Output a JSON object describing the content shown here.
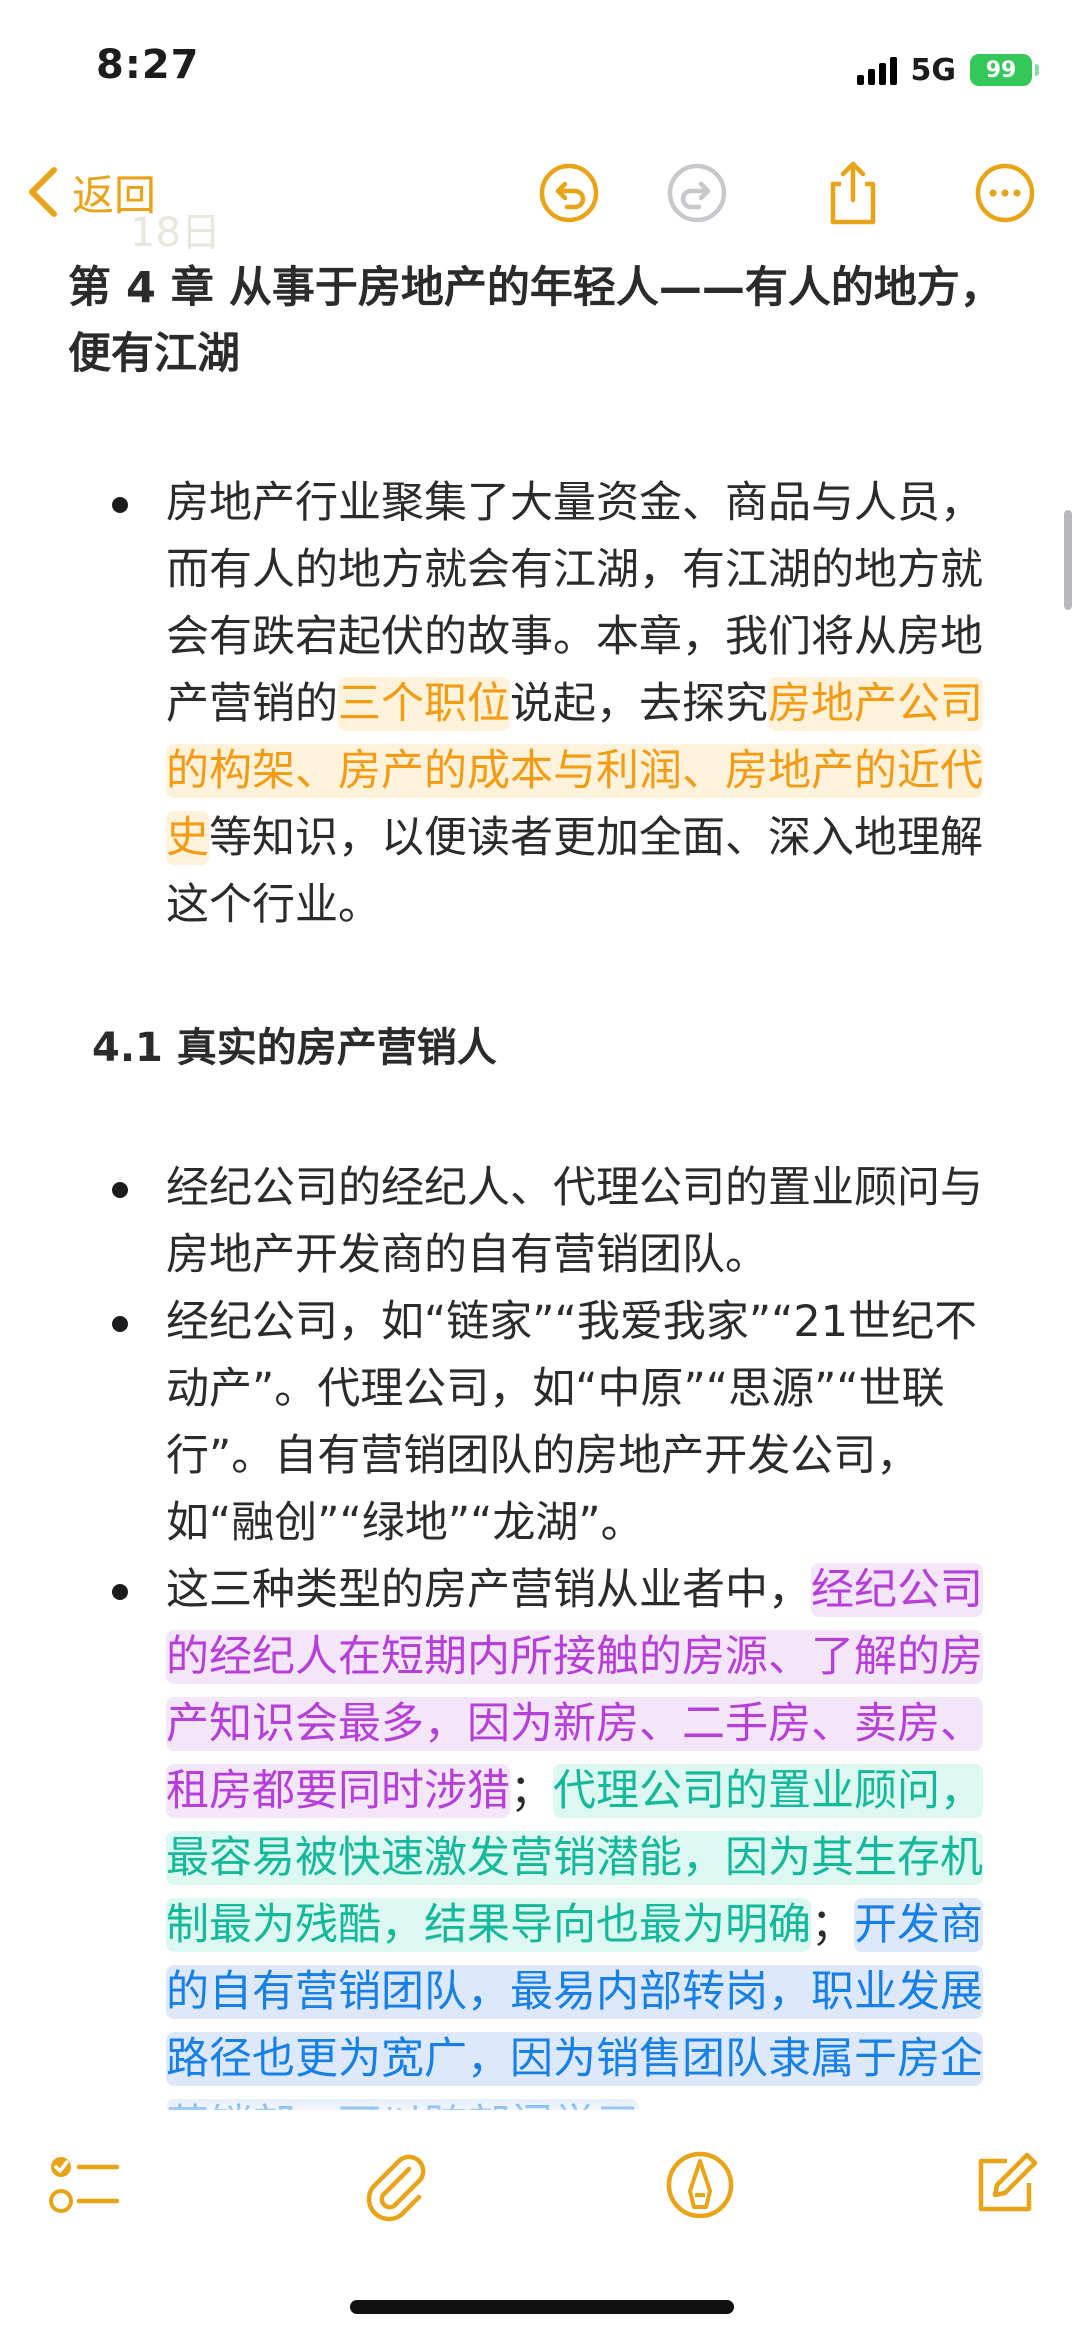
{
  "status_bar": {
    "time": "8:27",
    "network": "5G",
    "battery": "99"
  },
  "nav": {
    "back_label": "返回"
  },
  "ghost": {
    "top_line": "",
    "sub_line": "18日"
  },
  "chapter_title": "第 4 章 从事于房地产的年轻人——有人的地方，便有江湖",
  "bullets_intro": [
    {
      "parts": [
        {
          "text": "房地产行业聚集了大量资金、商品与人员，而有人的地方就会有江湖，有江湖的地方就会有跌宕起伏的故事。本章，我们将从房地产营销的",
          "hl": ""
        },
        {
          "text": "三个职位",
          "hl": "orange"
        },
        {
          "text": "说起，去探究",
          "hl": ""
        },
        {
          "text": "房地产公司的构架、房产的成本与利润、房地产的近代史",
          "hl": "orange"
        },
        {
          "text": "等知识，以便读者更加全面、深入地理解这个行业。",
          "hl": ""
        }
      ]
    }
  ],
  "section_title": "4.1 真实的房产营销人",
  "bullets_section": [
    {
      "parts": [
        {
          "text": "经纪公司的经纪人、代理公司的置业顾问与房地产开发商的自有营销团队。",
          "hl": ""
        }
      ]
    },
    {
      "parts": [
        {
          "text": "经纪公司，如“链家”“我爱我家”“21世纪不动产”。代理公司，如“中原”“思源”“世联行”。自有营销团队的房地产开发公司，如“融创”“绿地”“龙湖”。",
          "hl": ""
        }
      ]
    },
    {
      "parts": [
        {
          "text": "这三种类型的房产营销从业者中，",
          "hl": ""
        },
        {
          "text": "经纪公司的经纪人在短期内所接触的房源、了解的房产知识会最多，因为新房、二手房、卖房、租房都要同时涉猎",
          "hl": "purple"
        },
        {
          "text": "；",
          "hl": ""
        },
        {
          "text": "代理公司的置业顾问，最容易被快速激发营销潜能，因为其生存机制最为残酷，结果导向也最为明确",
          "hl": "teal"
        },
        {
          "text": "；",
          "hl": ""
        },
        {
          "text": "开发商的自有营销团队，最易内部转岗，职业发展路径也更为宽广，因为销售团队隶属于房企营销部，可以跨部门学习",
          "hl": "blue"
        }
      ]
    }
  ],
  "icons": {
    "back": "chevron-left-icon",
    "undo": "undo-icon",
    "redo": "redo-icon",
    "share": "share-icon",
    "more": "ellipsis-icon",
    "checklist": "checklist-icon",
    "attach": "paperclip-icon",
    "markup": "markup-pen-icon",
    "compose": "compose-icon"
  },
  "colors": {
    "accent": "#e8a317",
    "hl_orange": "#f49b14",
    "hl_purple": "#b73fd9",
    "hl_teal": "#14b89b",
    "hl_blue": "#1780e6"
  }
}
